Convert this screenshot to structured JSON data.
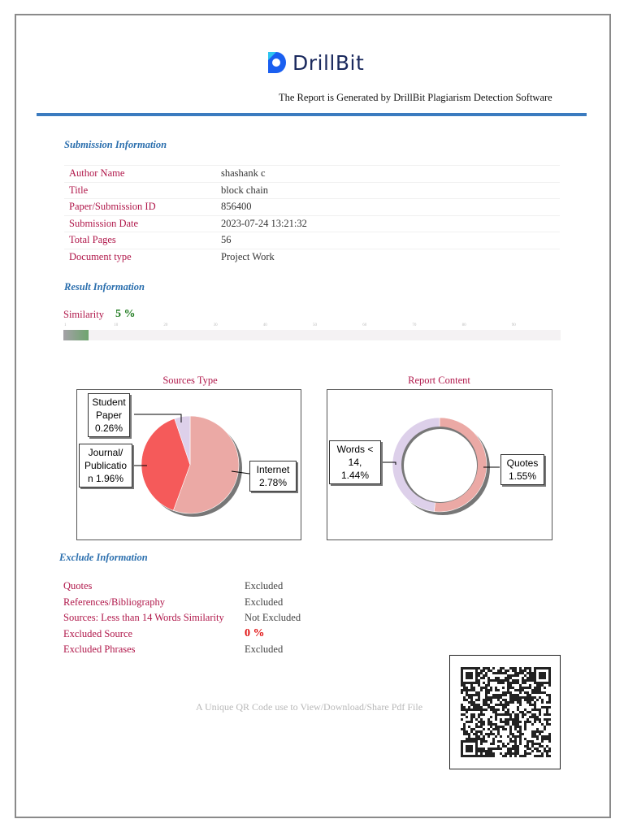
{
  "header": {
    "brand": "DrillBit",
    "tagline": "The Report is Generated by DrillBit Plagiarism Detection Software"
  },
  "submission": {
    "title": "Submission Information",
    "rows": [
      {
        "label": "Author Name",
        "value": "shashank c"
      },
      {
        "label": "Title",
        "value": "block chain"
      },
      {
        "label": "Paper/Submission ID",
        "value": "856400"
      },
      {
        "label": "Submission Date",
        "value": "2023-07-24 13:21:32"
      },
      {
        "label": "Total Pages",
        "value": "56"
      },
      {
        "label": "Document type",
        "value": "Project Work"
      }
    ]
  },
  "result": {
    "title": "Result Information",
    "similarity_label": "Similarity",
    "similarity_value": "5 %",
    "similarity_percent": 5,
    "ticks": [
      "1",
      "10",
      "20",
      "30",
      "40",
      "50",
      "60",
      "70",
      "80",
      "90"
    ]
  },
  "chart_data": [
    {
      "type": "pie",
      "title": "Sources Type",
      "slices": [
        {
          "name": "Internet",
          "label": "Internet 2.78%",
          "value": 2.78,
          "color": "#eba9a5"
        },
        {
          "name": "Journal/Publication",
          "label": "Journal/ Publicatio n 1.96%",
          "value": 1.96,
          "color": "#f55a5a"
        },
        {
          "name": "Student Paper",
          "label": "Student Paper 0.26%",
          "value": 0.26,
          "color": "#ddd0ea"
        }
      ]
    },
    {
      "type": "pie",
      "title": "Report Content",
      "donut": true,
      "slices": [
        {
          "name": "Quotes",
          "label": "Quotes 1.55%",
          "value": 1.55,
          "color": "#eba9a5"
        },
        {
          "name": "Words < 14",
          "label": "Words < 14, 1.44%",
          "value": 1.44,
          "color": "#ddd0ea"
        }
      ]
    }
  ],
  "exclude": {
    "title": "Exclude Information",
    "rows": [
      {
        "label": "Quotes",
        "value": "Excluded"
      },
      {
        "label": "References/Bibliography",
        "value": "Excluded"
      },
      {
        "label": "Sources: Less than 14 Words Similarity",
        "value": "Not Excluded"
      },
      {
        "label": "Excluded Source",
        "value": "0 %"
      },
      {
        "label": "Excluded Phrases",
        "value": "Excluded"
      }
    ]
  },
  "qr": {
    "caption": "A Unique QR Code use to View/Download/Share Pdf File"
  }
}
